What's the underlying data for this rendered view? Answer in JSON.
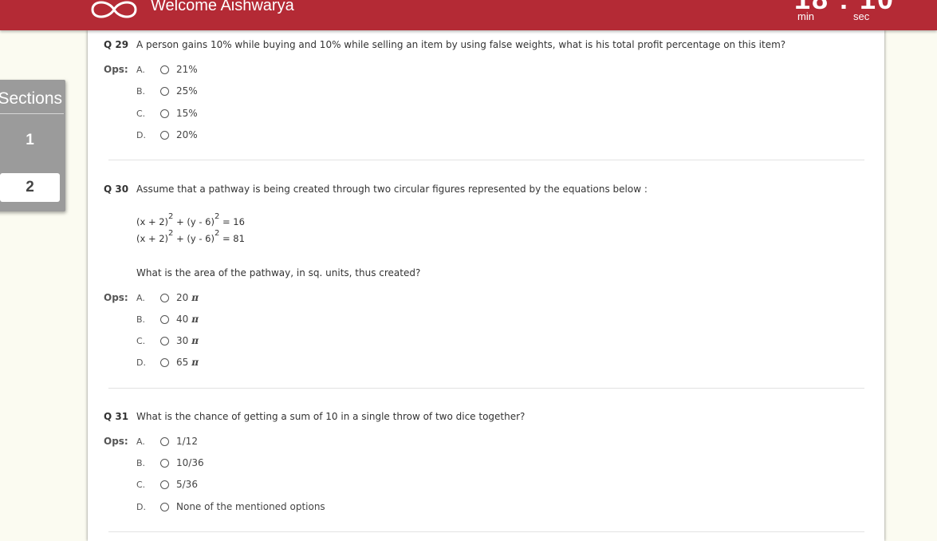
{
  "header": {
    "welcome": "Welcome Aishwarya",
    "timer_digits": "18 : 10",
    "min_label": "min",
    "sec_label": "sec",
    "brand_color": "#b42a35"
  },
  "sections_panel": {
    "title": "Sections",
    "items": [
      {
        "label": "1",
        "selected": false
      },
      {
        "label": "2",
        "selected": true
      }
    ]
  },
  "ops_label": "Ops:",
  "questions": [
    {
      "number": "Q 29",
      "text": "A person gains 10% while buying and 10% while selling an item by using false weights, what is his total profit percentage on this item?",
      "options": [
        {
          "letter": "A.",
          "text": "21%"
        },
        {
          "letter": "B.",
          "text": "25%"
        },
        {
          "letter": "C.",
          "text": "15%"
        },
        {
          "letter": "D.",
          "text": "20%"
        }
      ]
    },
    {
      "number": "Q 30",
      "text": "Assume that a pathway is being created through two circular figures represented by the equations below :",
      "equations": [
        {
          "a": "(x + 2)",
          "b": " + (y - 6)",
          "rhs": " = 16",
          "exp": "2"
        },
        {
          "a": "(x + 2)",
          "b": " + (y - 6)",
          "rhs": " = 81",
          "exp": "2"
        }
      ],
      "followup": "What is the area of the pathway, in sq. units, thus created?",
      "pi_symbol": "π",
      "options": [
        {
          "letter": "A.",
          "text": "20"
        },
        {
          "letter": "B.",
          "text": "40"
        },
        {
          "letter": "C.",
          "text": "30"
        },
        {
          "letter": "D.",
          "text": "65"
        }
      ]
    },
    {
      "number": "Q 31",
      "text": "What is the chance of getting a sum of 10 in a single throw of two dice together?",
      "options": [
        {
          "letter": "A.",
          "text": "1/12"
        },
        {
          "letter": "B.",
          "text": "10/36"
        },
        {
          "letter": "C.",
          "text": "5/36"
        },
        {
          "letter": "D.",
          "text": "None of the mentioned options"
        }
      ]
    }
  ]
}
